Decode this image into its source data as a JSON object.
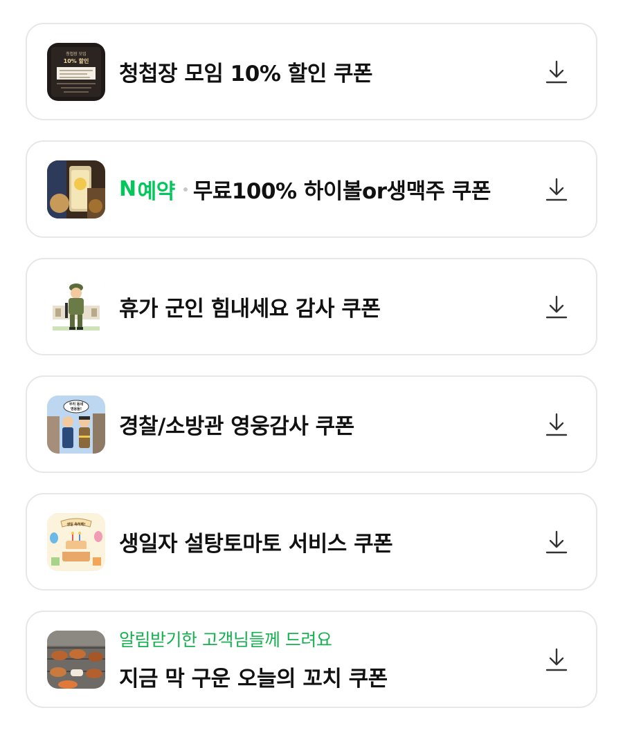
{
  "coupons": [
    {
      "title": "청첩장 모임 10% 할인 쿠폰",
      "thumb_icon": "invitation-card-image",
      "thumb_text": [
        "청첩장 모임",
        "10% 할인"
      ],
      "action_icon": "download-icon"
    },
    {
      "badge_text": "예약",
      "badge_logo": "N",
      "title": "무료100% 하이볼or생맥주 쿠폰",
      "thumb_icon": "highball-drink-image",
      "action_icon": "download-icon"
    },
    {
      "title": "휴가 군인 힘내세요 감사 쿠폰",
      "thumb_icon": "soldier-illustration",
      "action_icon": "download-icon"
    },
    {
      "title": "경찰/소방관 영웅감사 쿠폰",
      "thumb_icon": "police-firefighter-illustration",
      "thumb_text": [
        "우리 동네",
        "영웅들!"
      ],
      "action_icon": "download-icon"
    },
    {
      "title": "생일자 설탕토마토 서비스 쿠폰",
      "thumb_icon": "birthday-cake-illustration",
      "thumb_text": [
        "생일 축하해!"
      ],
      "action_icon": "download-icon"
    },
    {
      "subtitle": "알림받기한 고객님들께 드려요",
      "title": "지금 막 구운 오늘의 꼬치 쿠폰",
      "thumb_icon": "grilled-skewers-image",
      "action_icon": "download-icon"
    }
  ],
  "colors": {
    "naver_green": "#03c75a",
    "subtitle_green": "#17b050",
    "border": "#e7e7e9",
    "title_text": "#111111"
  }
}
